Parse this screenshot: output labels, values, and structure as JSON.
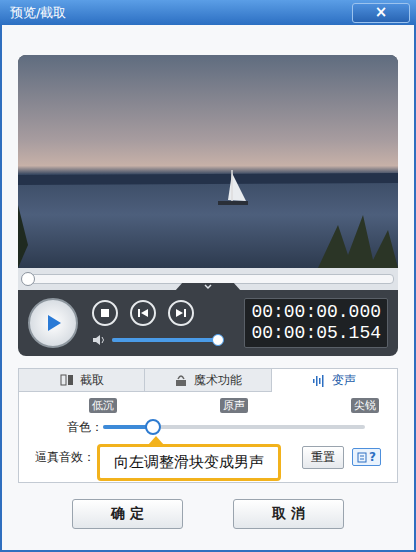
{
  "window": {
    "title": "预览/截取",
    "close": "×"
  },
  "player": {
    "seek_level": 0,
    "volume_level": 1.0,
    "time_current": "00:00:00.000",
    "time_total": "00:00:05.154",
    "playing": false
  },
  "tabs": [
    {
      "label": "截取",
      "selected": false
    },
    {
      "label": "魔术功能",
      "selected": false
    },
    {
      "label": "变声",
      "selected": true
    }
  ],
  "voice": {
    "label": "音色：",
    "marks": [
      "低沉",
      "原声",
      "尖锐"
    ],
    "level": 0.19
  },
  "effect": {
    "label": "逼真音效：",
    "reset": "重置",
    "help": "?"
  },
  "tooltip": "向左调整滑块变成男声",
  "buttons": [
    "确 定",
    "取 消"
  ]
}
